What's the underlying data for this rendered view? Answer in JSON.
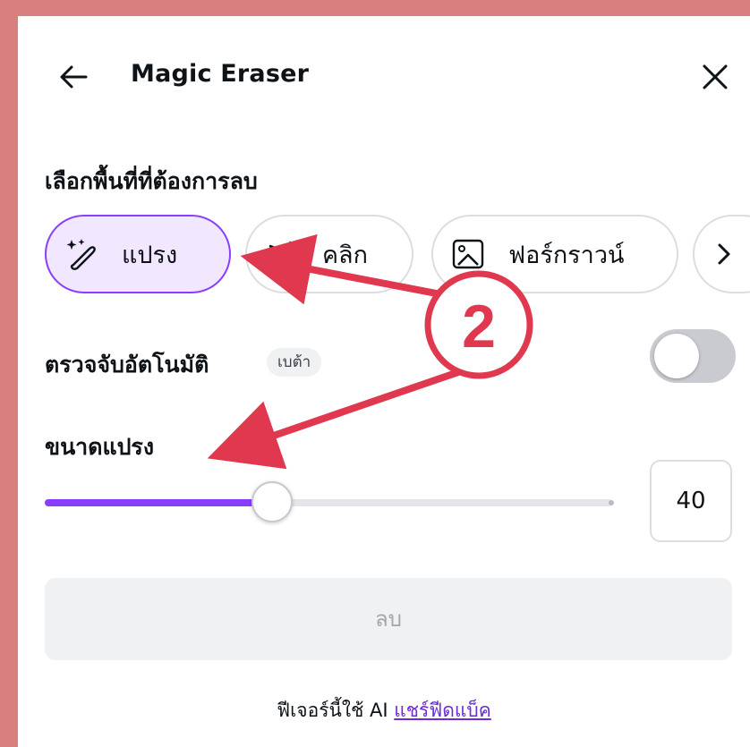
{
  "header": {
    "title": "Magic Eraser",
    "back_icon": "arrow-left-icon",
    "close_icon": "close-icon"
  },
  "select_area": {
    "label": "เลือกพื้นที่ที่ต้องการลบ",
    "modes": [
      {
        "label": "แปรง",
        "icon": "magic-brush-icon",
        "active": true
      },
      {
        "label": "คลิก",
        "icon": "magic-click-icon",
        "active": false
      },
      {
        "label": "ฟอร์กราวน์",
        "icon": "image-foreground-icon",
        "active": false
      }
    ],
    "more_icon": "chevron-right-icon"
  },
  "auto_detect": {
    "label": "ตรวจจับอัตโนมัติ",
    "badge": "เบต้า",
    "enabled": false
  },
  "brush_size": {
    "label": "ขนาดแปรง",
    "value": "40",
    "level_fraction": 0.4
  },
  "erase_button": "ลบ",
  "footer": {
    "text": "ฟีเจอร์นี้ใช้ AI",
    "link": "แชร์ฟีดแบ็ค"
  },
  "annotation": {
    "number": "2",
    "color": "#e0394f"
  },
  "colors": {
    "accent": "#8b3dff",
    "accent_light": "#f1e8ff",
    "background_frame": "#d97f7f"
  }
}
